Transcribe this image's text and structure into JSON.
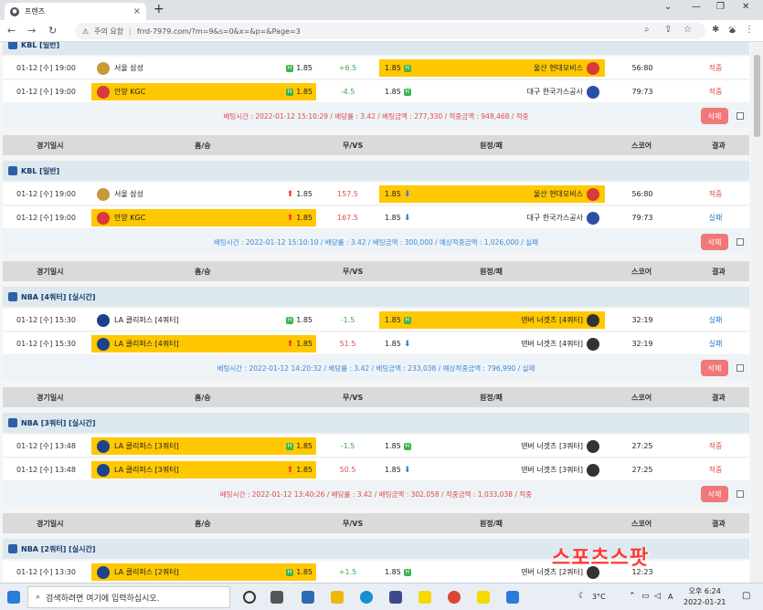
{
  "browser": {
    "tab_title": "프렌즈",
    "new_tab": "+",
    "url_prefix": "주의 요함",
    "url": "frrd-7979.com/?m=9&s=0&x=&p=&Page=3",
    "window_controls": [
      "⌄",
      "—",
      "❐",
      "✕"
    ]
  },
  "headers": {
    "date": "경기일시",
    "home": "홈/승",
    "draw": "무/VS",
    "away": "원정/패",
    "score": "스코어",
    "result": "결과"
  },
  "groups": [
    {
      "league": "KBL [일반]",
      "show_header": false,
      "rows": [
        {
          "date": "01-12 [수] 19:00",
          "home": "서울 삼성",
          "home_odd": "1.85",
          "home_mark": "badge",
          "home_sel": false,
          "hcp": "+6.5",
          "hcp_color": "green",
          "away": "울산 현대모비스",
          "away_odd": "1.85",
          "away_mark": "badge",
          "away_sel": true,
          "score": "56:80",
          "result": "적중",
          "result_color": "red",
          "home_logo": "#c59a3a",
          "away_logo": "#d93a3a"
        },
        {
          "date": "01-12 [수] 19:00",
          "home": "안양 KGC",
          "home_odd": "1.85",
          "home_mark": "badge",
          "home_sel": true,
          "hcp": "-4.5",
          "hcp_color": "green",
          "away": "대구 한국가스공사",
          "away_odd": "1.85",
          "away_mark": "badge",
          "away_sel": false,
          "score": "79:73",
          "result": "적중",
          "result_color": "red",
          "home_logo": "#d93a3a",
          "away_logo": "#2b4fa8"
        }
      ],
      "summary": "배팅시간 : 2022-01-12 15:10:29  /  배당률 : 3.42  /  배팅금액 : 277,330  /  적중금액 : 948,468  /  적중",
      "summary_color": "red",
      "delete": "삭제"
    },
    {
      "league": "KBL [일반]",
      "show_header": true,
      "rows": [
        {
          "date": "01-12 [수] 19:00",
          "home": "서울 삼성",
          "home_odd": "1.85",
          "home_mark": "up",
          "home_sel": false,
          "hcp": "157.5",
          "hcp_color": "red",
          "away": "울산 현대모비스",
          "away_odd": "1.85",
          "away_mark": "dn",
          "away_sel": true,
          "score": "56:80",
          "result": "적중",
          "result_color": "red",
          "home_logo": "#c59a3a",
          "away_logo": "#d93a3a"
        },
        {
          "date": "01-12 [수] 19:00",
          "home": "안양 KGC",
          "home_odd": "1.85",
          "home_mark": "up",
          "home_sel": true,
          "hcp": "167.5",
          "hcp_color": "red",
          "away": "대구 한국가스공사",
          "away_odd": "1.85",
          "away_mark": "dn",
          "away_sel": false,
          "score": "79:73",
          "result": "실패",
          "result_color": "blue",
          "home_logo": "#d93a3a",
          "away_logo": "#2b4fa8"
        }
      ],
      "summary": "배팅시간 : 2022-01-12 15:10:10  /  배당률 : 3.42  /  배팅금액 : 300,000  /  예상적중금액 : 1,026,000  /  실패",
      "summary_color": "blue",
      "delete": "삭제"
    },
    {
      "league": "NBA [4쿼터] [실시간]",
      "show_header": true,
      "rows": [
        {
          "date": "01-12 [수] 15:30",
          "home": "LA 클리퍼스 [4쿼터]",
          "home_odd": "1.85",
          "home_mark": "badge",
          "home_sel": false,
          "hcp": "-1.5",
          "hcp_color": "green",
          "away": "덴버 너겟츠 [4쿼터]",
          "away_odd": "1.85",
          "away_mark": "badge",
          "away_sel": true,
          "score": "32:19",
          "result": "실패",
          "result_color": "blue",
          "home_logo": "#1d428a",
          "away_logo": "#333"
        },
        {
          "date": "01-12 [수] 15:30",
          "home": "LA 클리퍼스 [4쿼터]",
          "home_odd": "1.85",
          "home_mark": "up",
          "home_sel": true,
          "hcp": "51.5",
          "hcp_color": "red",
          "away": "덴버 너겟츠 [4쿼터]",
          "away_odd": "1.85",
          "away_mark": "dn",
          "away_sel": false,
          "score": "32:19",
          "result": "실패",
          "result_color": "blue",
          "home_logo": "#1d428a",
          "away_logo": "#333"
        }
      ],
      "summary": "배팅시간 : 2022-01-12 14:20:32  /  배당률 : 3.42  /  배팅금액 : 233,038  /  예상적중금액 : 796,990  /  실패",
      "summary_color": "blue",
      "delete": "삭제"
    },
    {
      "league": "NBA [3쿼터] [실시간]",
      "show_header": true,
      "rows": [
        {
          "date": "01-12 [수] 13:48",
          "home": "LA 클리퍼스 [3쿼터]",
          "home_odd": "1.85",
          "home_mark": "badge",
          "home_sel": true,
          "hcp": "-1.5",
          "hcp_color": "green",
          "away": "덴버 너겟츠 [3쿼터]",
          "away_odd": "1.85",
          "away_mark": "badge",
          "away_sel": false,
          "score": "27:25",
          "result": "적중",
          "result_color": "red",
          "home_logo": "#1d428a",
          "away_logo": "#333"
        },
        {
          "date": "01-12 [수] 13:48",
          "home": "LA 클리퍼스 [3쿼터]",
          "home_odd": "1.85",
          "home_mark": "up",
          "home_sel": true,
          "hcp": "50.5",
          "hcp_color": "red",
          "away": "덴버 너겟츠 [3쿼터]",
          "away_odd": "1.85",
          "away_mark": "dn",
          "away_sel": false,
          "score": "27:25",
          "result": "적중",
          "result_color": "red",
          "home_logo": "#1d428a",
          "away_logo": "#333"
        }
      ],
      "summary": "배팅시간 : 2022-01-12 13:40:26  /  배당률 : 3.42  /  배팅금액 : 302,058  /  적중금액 : 1,033,038  /  적중",
      "summary_color": "red",
      "delete": "삭제"
    },
    {
      "league": "NBA [2쿼터] [실시간]",
      "show_header": true,
      "rows": [
        {
          "date": "01-12 [수] 13:30",
          "home": "LA 클리퍼스 [2쿼터]",
          "home_odd": "1.85",
          "home_mark": "badge",
          "home_sel": true,
          "hcp": "+1.5",
          "hcp_color": "green",
          "away": "덴버 너겟츠 [2쿼터]",
          "away_odd": "1.85",
          "away_mark": "badge",
          "away_sel": false,
          "score": "12:23",
          "result": "",
          "result_color": "red",
          "home_logo": "#1d428a",
          "away_logo": "#333"
        }
      ],
      "summary": "",
      "summary_color": "red",
      "delete": ""
    }
  ],
  "taskbar": {
    "search_placeholder": "검색하려면 여기에 입력하십시오.",
    "weather": "3°C",
    "time": "오후 6:24",
    "date": "2022-01-21",
    "lang": "A"
  },
  "watermark": "스포츠스팟"
}
